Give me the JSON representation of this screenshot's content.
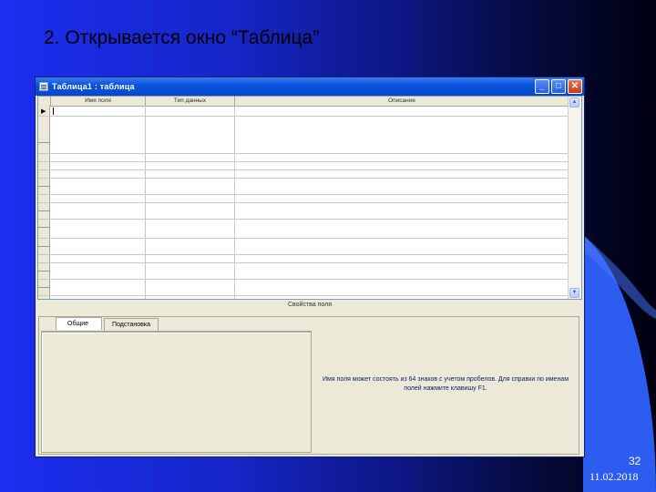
{
  "slide": {
    "title": "2. Открывается окно “Таблица”",
    "number": "32",
    "date": "11.02.2018"
  },
  "window": {
    "title": "Таблица1 : таблица",
    "buttons": {
      "minimize": "_",
      "maximize": "□",
      "close": "✕"
    }
  },
  "grid": {
    "columns": [
      "Имя поля",
      "Тип данных",
      "Описание"
    ],
    "current_row_marker": "▶"
  },
  "properties": {
    "label": "Свойства поля",
    "tabs": [
      "Общие",
      "Подстановка"
    ],
    "help_text": "Имя поля может состоять из 64 знаков с учетом пробелов. Для справки по именам полей нажмите клавишу F1."
  },
  "colors": {
    "titlebar": "#0a54e0",
    "window_bg": "#ece9d8",
    "help_text": "#0a246a",
    "slide_bg_left": "#1c2ef0"
  },
  "icons": {
    "system_menu": "table-icon",
    "scroll_up": "chevron-up-icon",
    "scroll_down": "chevron-down-icon"
  }
}
